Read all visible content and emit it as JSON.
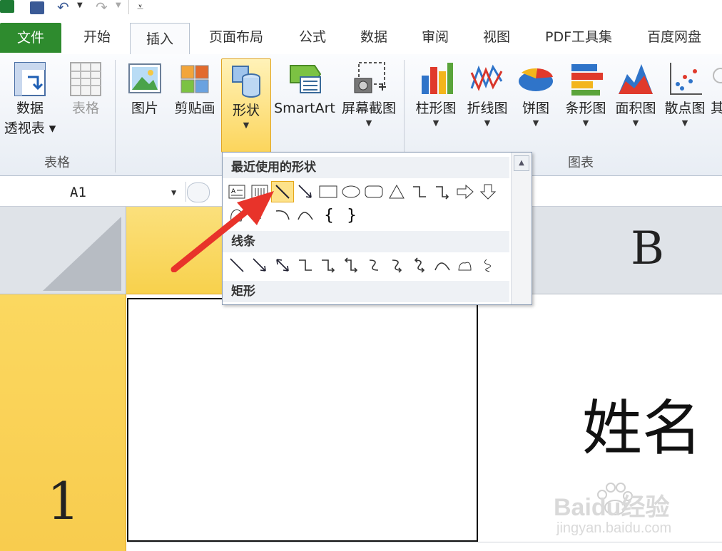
{
  "app": {
    "accent_file_tab": "#2e8b2e",
    "highlight": "#fbd25e"
  },
  "tabs": [
    {
      "label": "文件"
    },
    {
      "label": "开始"
    },
    {
      "label": "插入"
    },
    {
      "label": "页面布局"
    },
    {
      "label": "公式"
    },
    {
      "label": "数据"
    },
    {
      "label": "审阅"
    },
    {
      "label": "视图"
    },
    {
      "label": "PDF工具集"
    },
    {
      "label": "百度网盘"
    }
  ],
  "ribbon": {
    "groups": {
      "table": "表格",
      "charts": "图表"
    },
    "pivot": {
      "line1": "数据",
      "line2": "透视表"
    },
    "table_btn": "表格",
    "picture": "图片",
    "clipart": "剪贴画",
    "shapes": "形状",
    "smartart": "SmartArt",
    "screenshot": "屏幕截图",
    "charts": [
      "柱形图",
      "折线图",
      "饼图",
      "条形图",
      "面积图",
      "散点图",
      "其"
    ]
  },
  "formula_bar": {
    "name_box": "A1"
  },
  "shapes_dropdown": {
    "sections": [
      "最近使用的形状",
      "线条",
      "矩形"
    ],
    "recent_icons": [
      "text-box-icon",
      "vertical-text-box-icon",
      "line-icon",
      "arrow-line-icon",
      "rectangle-icon",
      "oval-icon",
      "rounded-rect-icon",
      "triangle-icon",
      "elbow-connector-icon",
      "elbow-arrow-icon",
      "right-arrow-icon",
      "down-arrow-icon"
    ],
    "line_icons": [
      "line-icon",
      "arrow-icon",
      "double-arrow-icon",
      "elbow-icon",
      "elbow-arrow-icon",
      "elbow-double-arrow-icon",
      "curve-icon",
      "curve-arrow-icon",
      "curve-double-arrow-icon",
      "arc-icon",
      "freeform-icon",
      "scribble-icon"
    ]
  },
  "grid": {
    "column_b": "B",
    "row_1": "1",
    "cell_b1": "姓名"
  },
  "watermark": {
    "brand": "Baidu经验",
    "url": "jingyan.baidu.com"
  }
}
